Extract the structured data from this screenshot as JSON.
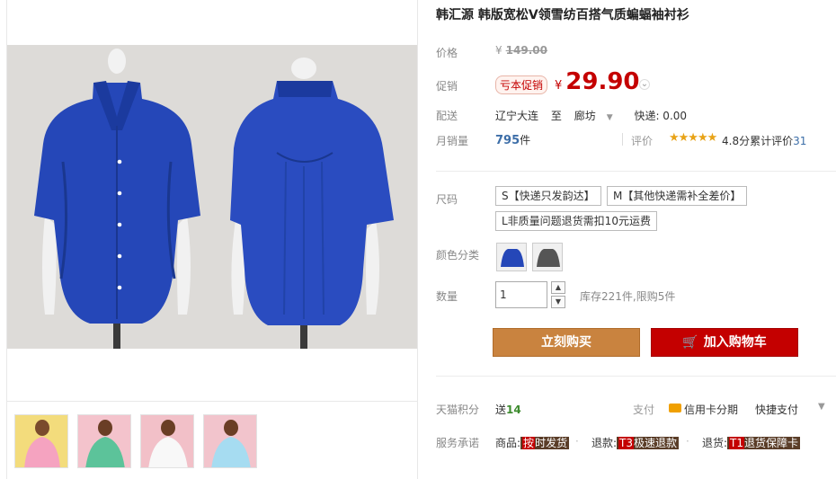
{
  "product": {
    "title": "韩汇源 韩版宽松V领雪纺百搭气质蝙蝠袖衬衫"
  },
  "price": {
    "label": "价格",
    "currency": "¥",
    "original": "149.00"
  },
  "promo": {
    "label": "促销",
    "tag": "亏本促销",
    "currency": "¥",
    "price": "29.90"
  },
  "shipping": {
    "label": "配送",
    "from": "辽宁大连",
    "to_word": "至",
    "to": "廊坊",
    "fee": "快递: 0.00"
  },
  "sales": {
    "label": "月销量",
    "value": "795",
    "unit": "件",
    "review_label": "评价",
    "stars": "★★★★★",
    "score": "4.8分",
    "review_text": "累计评价",
    "review_count": "31"
  },
  "size": {
    "label": "尺码",
    "options": [
      "S【快递只发韵达】",
      "M【其他快递需补全差价】",
      "L非质量问题退货需扣10元运费"
    ]
  },
  "color": {
    "label": "颜色分类",
    "swatches": [
      "blue",
      "dark-gray"
    ]
  },
  "quantity": {
    "label": "数量",
    "value": "1",
    "stock": "库存221件,限购5件"
  },
  "actions": {
    "buy_now": "立刻购买",
    "add_cart": "加入购物车"
  },
  "points": {
    "label": "天猫积分",
    "text": "送",
    "value": "14"
  },
  "payment": {
    "label": "支付",
    "card": "信用卡分期",
    "fast": "快捷支付"
  },
  "promise": {
    "label": "服务承诺",
    "items": [
      {
        "prefix": "商品:",
        "key": "按",
        "tag": "时发货"
      },
      {
        "prefix": "退款:",
        "key": "T3",
        "tag": "极速退款"
      },
      {
        "prefix": "退货:",
        "key": "T1",
        "tag": "退货保障卡"
      }
    ]
  },
  "colors": {
    "price_red": "#c40000",
    "buy_orange": "#c9833f",
    "cart_red": "#c40000",
    "shirt_blue": "#2347b8"
  },
  "thumbnails": [
    "pink-shirt-model",
    "green-shirt-model",
    "white-shirt-model",
    "lightblue-shirt-model"
  ]
}
